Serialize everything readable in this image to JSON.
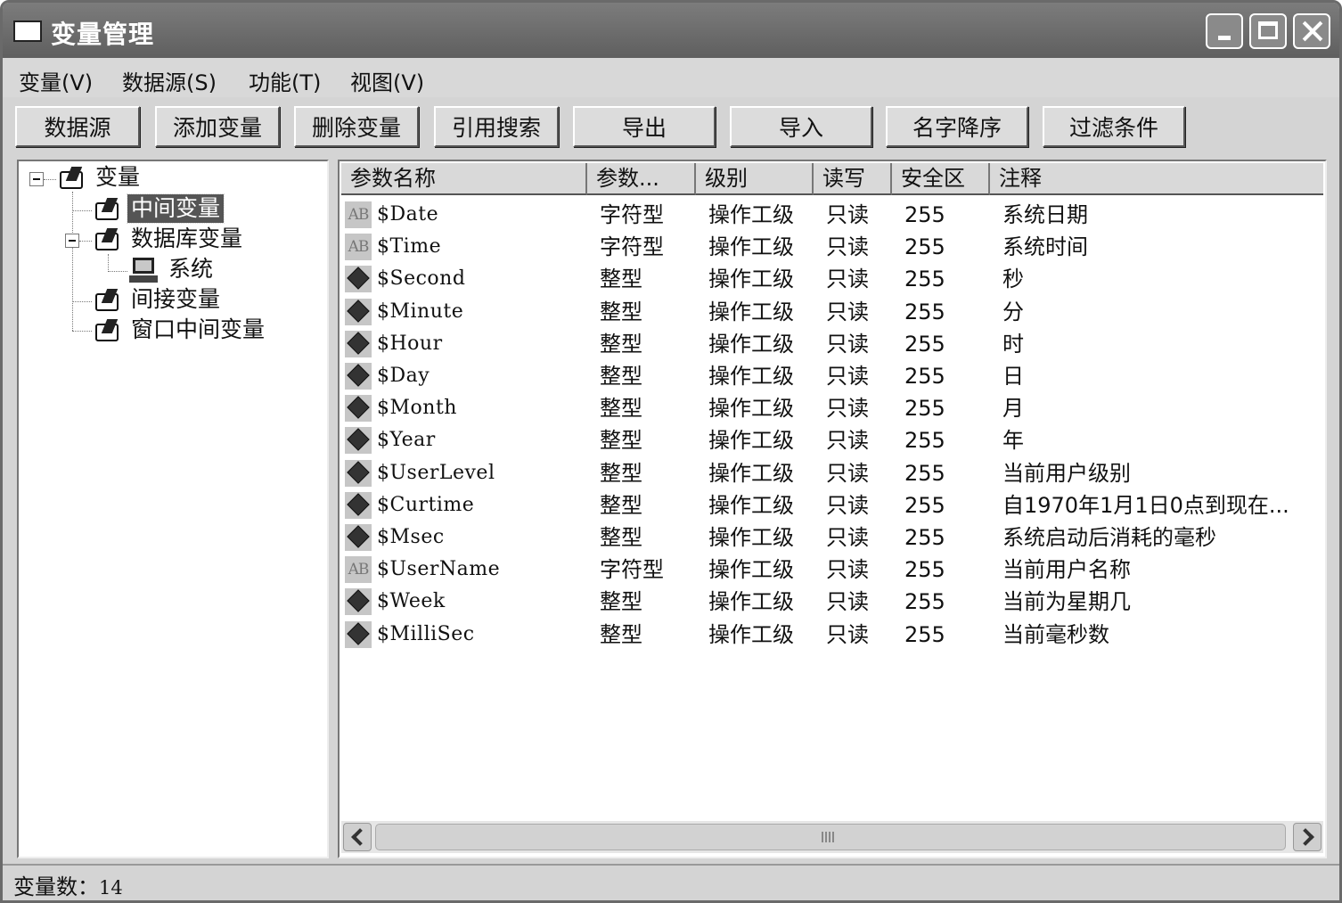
{
  "window": {
    "title": "变量管理"
  },
  "menu": [
    "变量(V)",
    "数据源(S)",
    "功能(T)",
    "视图(V)"
  ],
  "toolbar": [
    "数据源",
    "添加变量",
    "删除变量",
    "引用搜索",
    "导出",
    "导入",
    "名字降序",
    "过滤条件"
  ],
  "tree": {
    "root": "变量",
    "items": [
      "中间变量",
      "数据库变量",
      "系统",
      "间接变量",
      "窗口中间变量"
    ],
    "selected": "中间变量"
  },
  "list": {
    "columns": [
      "参数名称",
      "参数...",
      "级别",
      "读写",
      "安全区",
      "注释"
    ],
    "rows": [
      {
        "icon": "text-type-icon",
        "name": "$Date",
        "type": "字符型",
        "level": "操作工级",
        "rw": "只读",
        "zone": "255",
        "note": "系统日期"
      },
      {
        "icon": "text-type-icon",
        "name": "$Time",
        "type": "字符型",
        "level": "操作工级",
        "rw": "只读",
        "zone": "255",
        "note": "系统时间"
      },
      {
        "icon": "integer-type-icon",
        "name": "$Second",
        "type": "整型",
        "level": "操作工级",
        "rw": "只读",
        "zone": "255",
        "note": "秒"
      },
      {
        "icon": "integer-type-icon",
        "name": "$Minute",
        "type": "整型",
        "level": "操作工级",
        "rw": "只读",
        "zone": "255",
        "note": "分"
      },
      {
        "icon": "integer-type-icon",
        "name": "$Hour",
        "type": "整型",
        "level": "操作工级",
        "rw": "只读",
        "zone": "255",
        "note": "时"
      },
      {
        "icon": "integer-type-icon",
        "name": "$Day",
        "type": "整型",
        "level": "操作工级",
        "rw": "只读",
        "zone": "255",
        "note": "日"
      },
      {
        "icon": "integer-type-icon",
        "name": "$Month",
        "type": "整型",
        "level": "操作工级",
        "rw": "只读",
        "zone": "255",
        "note": "月"
      },
      {
        "icon": "integer-type-icon",
        "name": "$Year",
        "type": "整型",
        "level": "操作工级",
        "rw": "只读",
        "zone": "255",
        "note": "年"
      },
      {
        "icon": "integer-type-icon",
        "name": "$UserLevel",
        "type": "整型",
        "level": "操作工级",
        "rw": "只读",
        "zone": "255",
        "note": "当前用户级别"
      },
      {
        "icon": "integer-type-icon",
        "name": "$Curtime",
        "type": "整型",
        "level": "操作工级",
        "rw": "只读",
        "zone": "255",
        "note": "自1970年1月1日0点到现在..."
      },
      {
        "icon": "integer-type-icon",
        "name": "$Msec",
        "type": "整型",
        "level": "操作工级",
        "rw": "只读",
        "zone": "255",
        "note": "系统启动后消耗的毫秒"
      },
      {
        "icon": "text-type-icon",
        "name": "$UserName",
        "type": "字符型",
        "level": "操作工级",
        "rw": "只读",
        "zone": "255",
        "note": "当前用户名称"
      },
      {
        "icon": "integer-type-icon",
        "name": "$Week",
        "type": "整型",
        "level": "操作工级",
        "rw": "只读",
        "zone": "255",
        "note": "当前为星期几"
      },
      {
        "icon": "integer-type-icon",
        "name": "$MilliSec",
        "type": "整型",
        "level": "操作工级",
        "rw": "只读",
        "zone": "255",
        "note": "当前毫秒数"
      }
    ]
  },
  "text_icon_label": "AB",
  "status": {
    "label": "变量数：",
    "count": "14"
  }
}
